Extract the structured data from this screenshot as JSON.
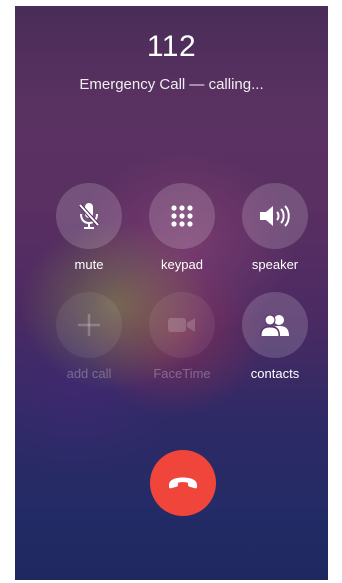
{
  "call": {
    "number": "112",
    "status": "Emergency Call — calling..."
  },
  "controls": [
    {
      "label": "mute",
      "icon": "microphone-slash-icon",
      "enabled": true
    },
    {
      "label": "keypad",
      "icon": "keypad-grid-icon",
      "enabled": true
    },
    {
      "label": "speaker",
      "icon": "speaker-icon",
      "enabled": true
    },
    {
      "label": "add call",
      "icon": "plus-icon",
      "enabled": false
    },
    {
      "label": "FaceTime",
      "icon": "video-camera-icon",
      "enabled": false
    },
    {
      "label": "contacts",
      "icon": "contacts-icon",
      "enabled": true
    }
  ],
  "end_call": {
    "icon": "end-call-icon",
    "color": "#f0453a"
  },
  "colors": {
    "button_fill": "rgba(255,255,255,0.17)",
    "disabled_text": "rgba(255,255,255,0.28)"
  }
}
